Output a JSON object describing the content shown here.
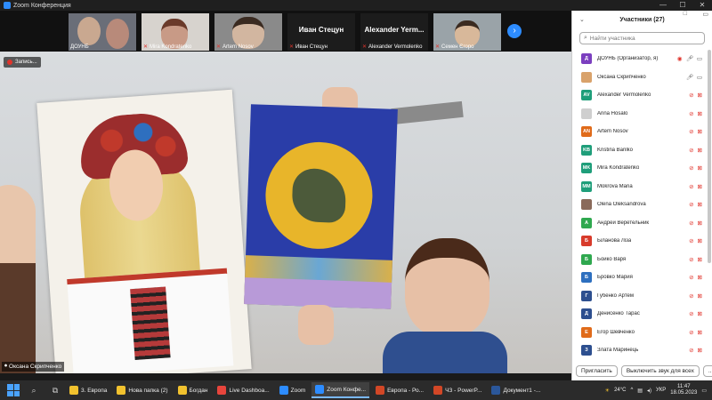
{
  "window": {
    "title": "Zoom Конференция"
  },
  "strip": {
    "tiles": [
      {
        "name": "ДОУНБ",
        "muted": false
      },
      {
        "name": "Mira Kondratenko",
        "muted": true
      },
      {
        "name": "Artem Nosov",
        "muted": true
      },
      {
        "name": "Иван Стецун",
        "muted": true,
        "big": "Иван  Стецун"
      },
      {
        "name": "Alexander Vermolenko",
        "muted": true,
        "big": "Alexander  Yerm..."
      },
      {
        "name": "Семен Єгоро",
        "muted": true
      }
    ]
  },
  "main": {
    "recording_label": "Запись...",
    "speaker_name": "Оксана Скрипченко"
  },
  "panel": {
    "title": "Участники (27)",
    "search_placeholder": "Найти участника",
    "participants": [
      {
        "initials": "Д",
        "color": "#7b3fbf",
        "name": "ДОУНБ (Организатор, я)",
        "icons": "rec-mic-cam"
      },
      {
        "initials": "",
        "color": "#d9a26b",
        "name": "Оксана Скрипченко",
        "icons": "mic-cam"
      },
      {
        "initials": "AV",
        "color": "#1f9e7a",
        "name": "Alexander Vermolenko",
        "icons": "off"
      },
      {
        "initials": "",
        "color": "#cfcfcf",
        "name": "Arina Hosalo",
        "icons": "off"
      },
      {
        "initials": "AN",
        "color": "#e06b1a",
        "name": "Artem Nosov",
        "icons": "off"
      },
      {
        "initials": "KB",
        "color": "#1f9e7a",
        "name": "Kristina Barilko",
        "icons": "off"
      },
      {
        "initials": "MK",
        "color": "#1f9e7a",
        "name": "Mira Kondratenko",
        "icons": "off"
      },
      {
        "initials": "MM",
        "color": "#1f9e7a",
        "name": "Mokrova Maria",
        "icons": "off"
      },
      {
        "initials": "",
        "color": "#8a6a5a",
        "name": "Olena Oleksandrova",
        "icons": "off"
      },
      {
        "initials": "А",
        "color": "#2fa84f",
        "name": "Андрей Веретельник",
        "icons": "off"
      },
      {
        "initials": "Б",
        "color": "#d83b2b",
        "name": "Біланова Ліза",
        "icons": "off"
      },
      {
        "initials": "Б",
        "color": "#2fa84f",
        "name": "Бойко Варя",
        "icons": "off"
      },
      {
        "initials": "Б",
        "color": "#2d6fbf",
        "name": "Бровко Мария",
        "icons": "off"
      },
      {
        "initials": "Г",
        "color": "#2d4f8f",
        "name": "Губенко Артем",
        "icons": "off"
      },
      {
        "initials": "Д",
        "color": "#2d4f8f",
        "name": "Денисенко Тарас",
        "icons": "off"
      },
      {
        "initials": "Е",
        "color": "#e06b1a",
        "name": "Егор Шевченко",
        "icons": "off"
      },
      {
        "initials": "З",
        "color": "#2d4f8f",
        "name": "Злата Маринець",
        "icons": "off"
      }
    ],
    "invite_label": "Пригласить",
    "mute_all_label": "Выключить звук для всех",
    "more_label": "..."
  },
  "taskbar": {
    "items": [
      {
        "label": "3. Европа",
        "color": "#f2c22e",
        "active": false
      },
      {
        "label": "Нова папка (2)",
        "color": "#f2c22e",
        "active": false
      },
      {
        "label": "Богдан",
        "color": "#f2c22e",
        "active": false
      },
      {
        "label": "Live Dashboa...",
        "color": "#e8453c",
        "active": false
      },
      {
        "label": "Zoom",
        "color": "#2d8cff",
        "active": false
      },
      {
        "label": "Zoom Конфе...",
        "color": "#2d8cff",
        "active": true
      },
      {
        "label": "Европа - Ро...",
        "color": "#d24726",
        "active": false
      },
      {
        "label": "ЧЗ - PowerP...",
        "color": "#d24726",
        "active": false
      },
      {
        "label": "Документ1 -...",
        "color": "#2b579a",
        "active": false
      }
    ],
    "weather": "24°C",
    "lang": "УКР",
    "time": "11:47",
    "date": "18.05.2023"
  }
}
